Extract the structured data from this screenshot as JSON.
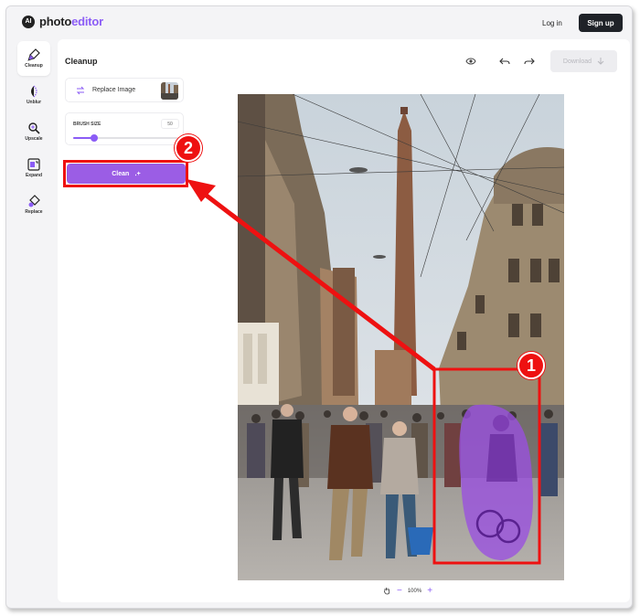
{
  "header": {
    "logo_badge": "AI",
    "logo_text_a": "photo",
    "logo_text_b": "editor",
    "login_label": "Log in",
    "signup_label": "Sign up"
  },
  "sidebar": {
    "items": [
      {
        "label": "Cleanup",
        "icon": "brush-icon",
        "active": true
      },
      {
        "label": "Unblur",
        "icon": "unblur-icon",
        "active": false
      },
      {
        "label": "Upscale",
        "icon": "upscale-icon",
        "active": false
      },
      {
        "label": "Expand",
        "icon": "expand-icon",
        "active": false
      },
      {
        "label": "Replace",
        "icon": "replace-icon",
        "active": false
      }
    ]
  },
  "panel": {
    "title": "Cleanup",
    "download_label": "Download",
    "replace_label": "Replace Image",
    "brush_label": "BRUSH SIZE",
    "brush_value": "50",
    "brush_fraction": 0.2,
    "clean_label": "Clean",
    "clean_suffix": "․+"
  },
  "zoom": {
    "minus": "−",
    "value": "100%",
    "plus": "+"
  },
  "annotations": {
    "step1": "1",
    "step2": "2",
    "color": "#ee1111"
  },
  "colors": {
    "accent": "#8b5cf6",
    "button": "#9b5de5",
    "dark": "#1f2228"
  }
}
